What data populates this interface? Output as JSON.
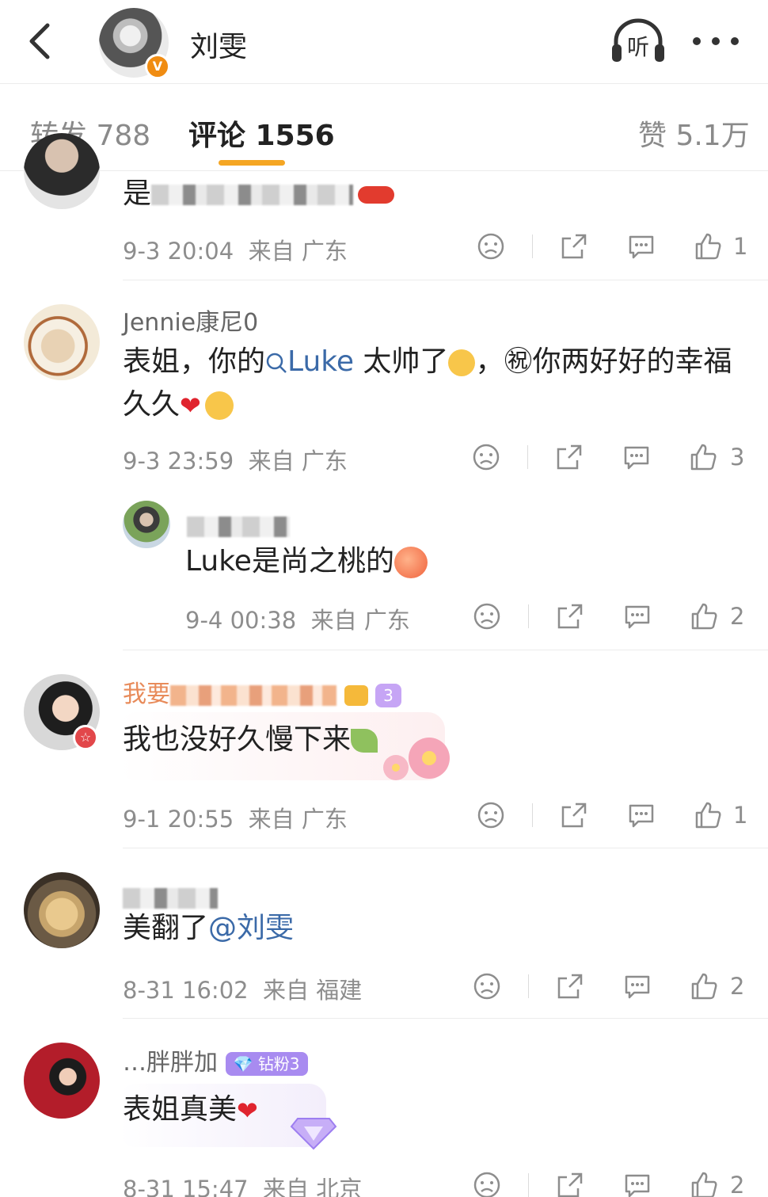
{
  "header": {
    "title": "刘雯",
    "verified_mark": "V",
    "listen_label": "听"
  },
  "tabs": {
    "repost": "转发 788",
    "comments": "评论 1556",
    "likes": "赞 5.1万"
  },
  "colors": {
    "accent": "#f5a623",
    "link": "#3b6aa8",
    "verified": "#f08c12"
  },
  "comments": [
    {
      "text_partial": "是",
      "time": "9-3 20:04",
      "from": "来自 广东",
      "like_count": "1"
    },
    {
      "username": "Jennie康尼0",
      "text_a": "表姐，你的",
      "mention": "Luke",
      "text_b": "太帅了",
      "text_c": "，㊗你两好好的幸福",
      "text_d": "久久",
      "time": "9-3 23:59",
      "from": "来自 广东",
      "like_count": "3"
    },
    {
      "text": "Luke是尚之桃的",
      "time": "9-4 00:38",
      "from": "来自 广东",
      "like_count": "2"
    },
    {
      "username_partial": "我要",
      "badge_level": "3",
      "text": "我也没好久慢下来",
      "time": "9-1 20:55",
      "from": "来自 广东",
      "like_count": "1"
    },
    {
      "text": "美翻了",
      "mention": "@刘雯",
      "time": "8-31 16:02",
      "from": "来自 福建",
      "like_count": "2"
    },
    {
      "username": "…胖胖加",
      "badge": "钻粉3",
      "text": "表姐真美",
      "time": "8-31 15:47",
      "from": "来自 北京",
      "like_count": "2"
    }
  ],
  "icons": [
    "back-icon",
    "listen-icon",
    "more-icon",
    "dislike-icon",
    "share-icon",
    "reply-icon",
    "like-icon",
    "search-icon"
  ]
}
